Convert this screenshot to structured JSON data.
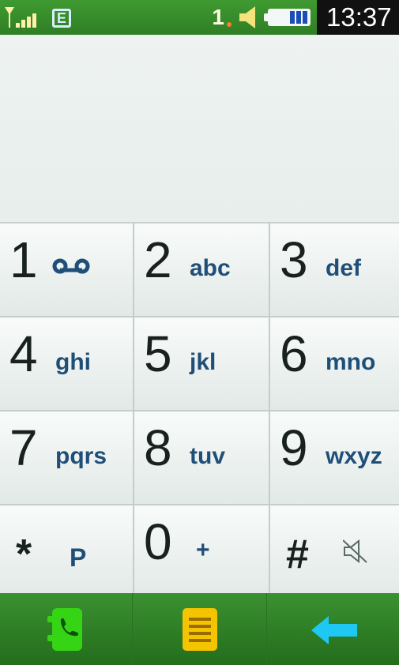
{
  "status_bar": {
    "network_label": "E",
    "sim_number": "1",
    "time": "13:37",
    "icons": [
      "signal-icon",
      "network-e-icon",
      "speaker-icon",
      "battery-icon"
    ]
  },
  "dialer": {
    "number_display": "",
    "keys": [
      {
        "digit": "1",
        "sub": "voicemail-icon"
      },
      {
        "digit": "2",
        "sub": "abc"
      },
      {
        "digit": "3",
        "sub": "def"
      },
      {
        "digit": "4",
        "sub": "ghi"
      },
      {
        "digit": "5",
        "sub": "jkl"
      },
      {
        "digit": "6",
        "sub": "mno"
      },
      {
        "digit": "7",
        "sub": "pqrs"
      },
      {
        "digit": "8",
        "sub": "tuv"
      },
      {
        "digit": "9",
        "sub": "wxyz"
      },
      {
        "digit": "*",
        "sub": "P"
      },
      {
        "digit": "0",
        "sub": "+"
      },
      {
        "digit": "#",
        "sub": "mute-icon"
      }
    ]
  },
  "bottom_bar": {
    "icons": [
      "call-icon",
      "contacts-icon",
      "backspace-icon"
    ]
  },
  "colors": {
    "bar_green": "#2f7f24",
    "key_text": "#18211e",
    "letters": "#1f4f78",
    "call_green": "#35d414",
    "contacts_yellow": "#f5c400",
    "backspace_cyan": "#1ec8f2"
  }
}
